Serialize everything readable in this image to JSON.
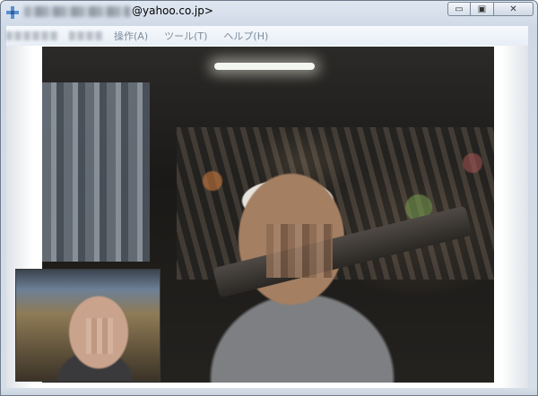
{
  "window": {
    "title_visible": "@yahoo.co.jp>",
    "caption": {
      "minimize": "▭",
      "maximize": "▣",
      "close": "✕"
    }
  },
  "menubar": {
    "items": [
      "操作(A)",
      "ツール(T)",
      "ヘルプ(H)"
    ]
  },
  "icons": {
    "app": "messenger-app-icon",
    "window_minimize": "minimize-icon",
    "window_maximize": "maximize-icon",
    "window_close": "close-icon"
  },
  "colors": {
    "frame": "#dfe7f1",
    "menu_text_disabled": "#7d8c9c",
    "video_bg": "#1a1917"
  }
}
